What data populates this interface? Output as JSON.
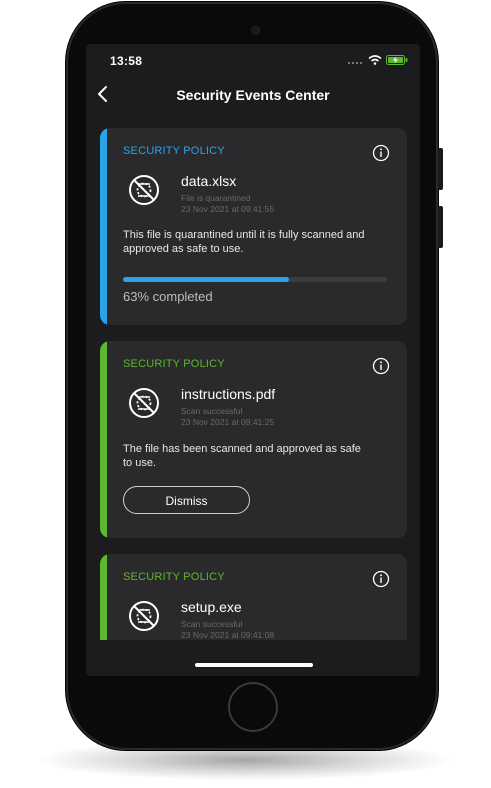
{
  "status_bar": {
    "time": "13:58",
    "signal_icon": "signal-icon",
    "wifi_icon": "wifi-icon",
    "battery_icon": "battery-charging-icon"
  },
  "nav": {
    "back_icon": "chevron-left-icon",
    "title": "Security Events Center"
  },
  "colors": {
    "blue_accent": "#29a3ea",
    "green_accent": "#5cb82e",
    "background": "#1c1c1e",
    "card": "#2a2a2c"
  },
  "events": [
    {
      "policy_label": "SECURITY POLICY",
      "accent": "blue",
      "file_name": "data.xlsx",
      "status": "File is quarantined",
      "date": "23 Nov 2021 at 09:41:55",
      "description": "This file is quarantined until it is fully scanned and approved as safe to use.",
      "progress": 0.63,
      "progress_text": "63% completed"
    },
    {
      "policy_label": "SECURITY POLICY",
      "accent": "green",
      "file_name": "instructions.pdf",
      "status": "Scan successful",
      "date": "23 Nov 2021 at 09:41:25",
      "description": "The file has been scanned and approved as safe to use.",
      "dismiss_label": "Dismiss"
    },
    {
      "policy_label": "SECURITY POLICY",
      "accent": "green",
      "file_name": "setup.exe",
      "status": "Scan successful",
      "date": "23 Nov 2021 at 09:41:08"
    }
  ]
}
